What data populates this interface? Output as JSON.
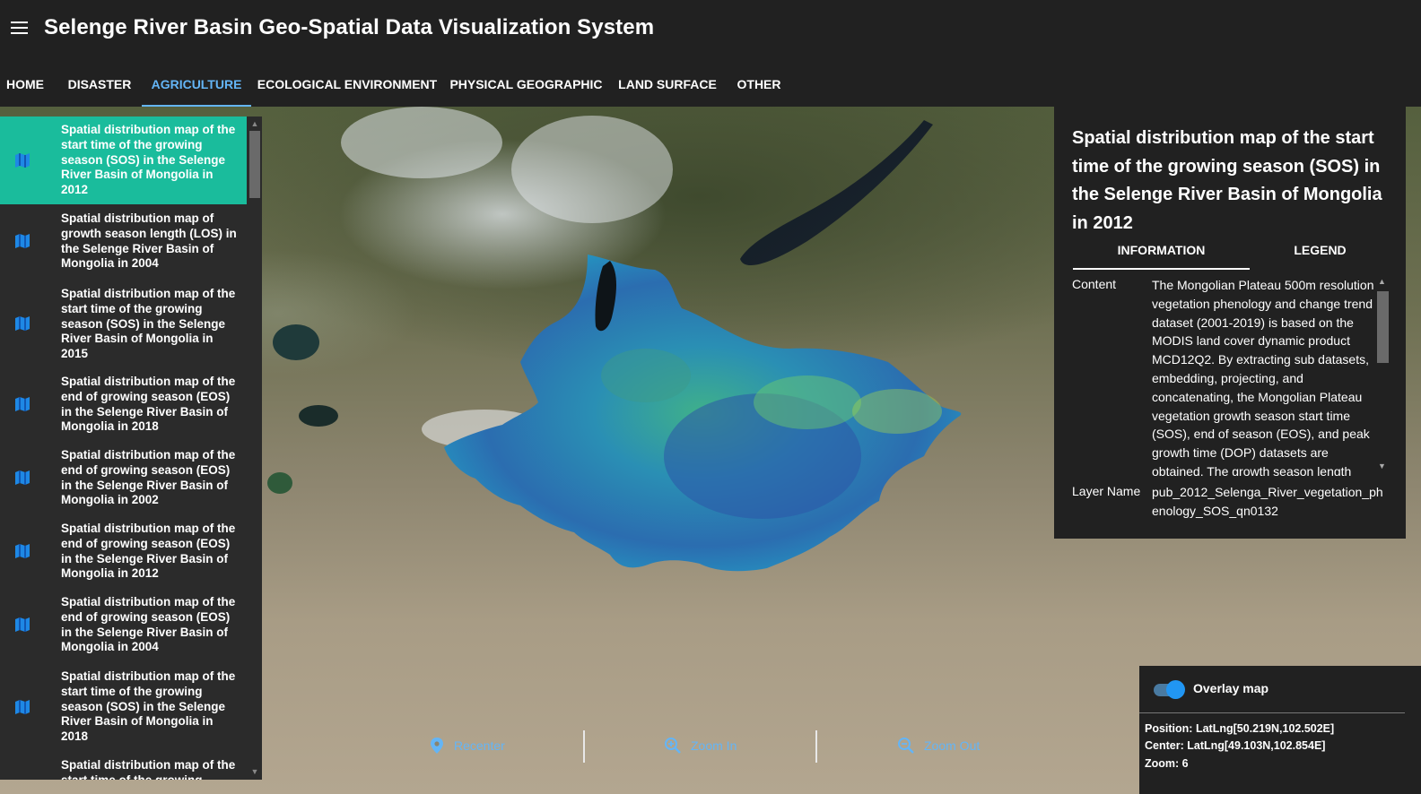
{
  "header": {
    "title": "Selenge River Basin Geo-Spatial Data Visualization System"
  },
  "tabs": [
    {
      "label": "HOME",
      "active": false
    },
    {
      "label": "DISASTER",
      "active": false
    },
    {
      "label": "AGRICULTURE",
      "active": true
    },
    {
      "label": "ECOLOGICAL ENVIRONMENT",
      "active": false
    },
    {
      "label": "PHYSICAL GEOGRAPHIC",
      "active": false
    },
    {
      "label": "LAND SURFACE",
      "active": false
    },
    {
      "label": "OTHER",
      "active": false
    }
  ],
  "sidebar": {
    "items": [
      {
        "label": "Spatial distribution map of the start time of the growing season (SOS) in the Selenge River Basin of Mongolia in 2012",
        "selected": true,
        "icon": "map-icon"
      },
      {
        "label": "Spatial distribution map of growth season length (LOS) in the Selenge River Basin of Mongolia in 2004",
        "selected": false,
        "icon": "map-icon"
      },
      {
        "label": "Spatial distribution map of the start time of the growing season (SOS) in the Selenge River Basin of Mongolia in 2015",
        "selected": false,
        "icon": "map-icon"
      },
      {
        "label": "Spatial distribution map of the end of growing season (EOS) in the Selenge River Basin of Mongolia in 2018",
        "selected": false,
        "icon": "map-icon"
      },
      {
        "label": "Spatial distribution map of the end of growing season (EOS) in the Selenge River Basin of Mongolia in 2002",
        "selected": false,
        "icon": "map-icon"
      },
      {
        "label": "Spatial distribution map of the end of growing season (EOS) in the Selenge River Basin of Mongolia in 2012",
        "selected": false,
        "icon": "map-icon"
      },
      {
        "label": "Spatial distribution map of the end of growing season (EOS) in the Selenge River Basin of Mongolia in 2004",
        "selected": false,
        "icon": "map-icon"
      },
      {
        "label": "Spatial distribution map of the start time of the growing season (SOS) in the Selenge River Basin of Mongolia in 2018",
        "selected": false,
        "icon": "map-icon"
      },
      {
        "label": "Spatial distribution map of the start time of the growing",
        "selected": false,
        "icon": "map-icon"
      }
    ]
  },
  "info_panel": {
    "title": "Spatial distribution map of the start time of the growing season (SOS) in the Selenge River Basin of Mongolia in 2012",
    "tabs": [
      {
        "label": "INFORMATION",
        "active": true
      },
      {
        "label": "LEGEND",
        "active": false
      }
    ],
    "content_label": "Content",
    "content_text": "The Mongolian Plateau 500m resolution vegetation phenology and change trend dataset (2001-2019) is based on the MODIS land cover dynamic product MCD12Q2. By extracting sub datasets, embedding, projecting, and concatenating, the Mongolian Plateau vegetation growth season start time (SOS), end of season (EOS), and peak growth time (DOP) datasets are obtained. The growth season length",
    "layer_label": "Layer Name",
    "layer_value": "pub_2012_Selenga_River_vegetation_phenology_SOS_qn0132"
  },
  "map_controls": {
    "recenter": "Recenter",
    "zoom_in": "Zoom In",
    "zoom_out": "Zoom Out"
  },
  "overlay": {
    "label": "Overlay map",
    "enabled": true,
    "position": "Position: LatLng[50.219N,102.502E]",
    "center": "Center: LatLng[49.103N,102.854E]",
    "zoom": "Zoom: 6"
  },
  "colors": {
    "accent": "#64b5f6",
    "selected_item": "#1abc9c",
    "panel_bg": "#212121"
  }
}
